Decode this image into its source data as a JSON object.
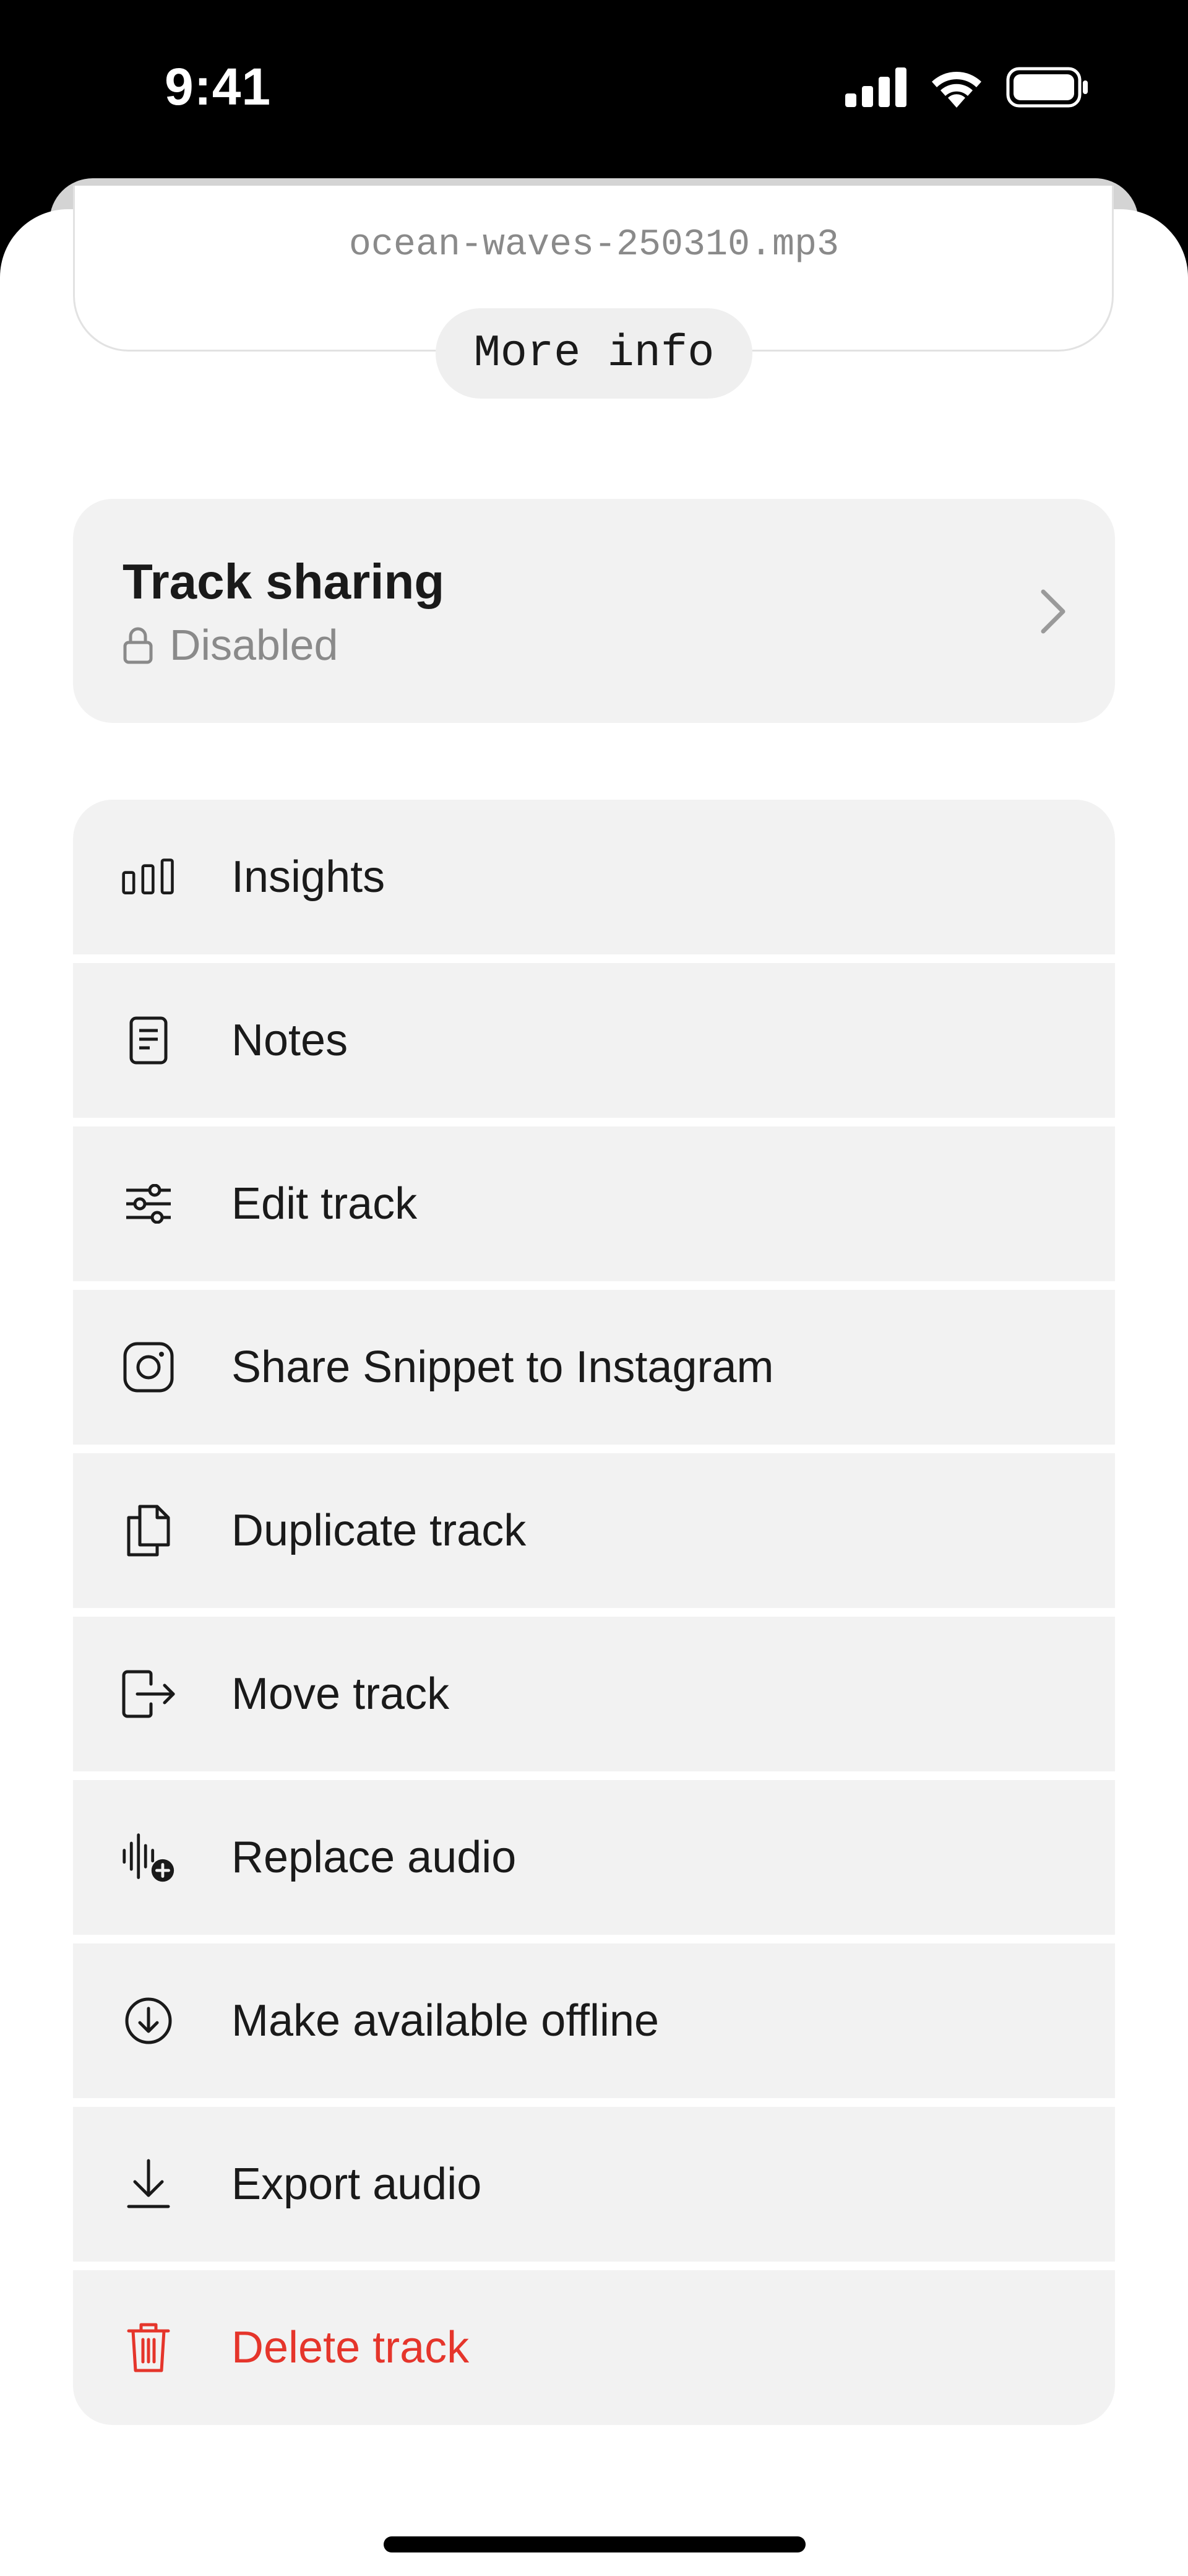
{
  "status_bar": {
    "time": "9:41",
    "icons": [
      "cellular-signal-icon",
      "wifi-icon",
      "battery-icon"
    ]
  },
  "file": {
    "name": "ocean-waves-250310.mp3",
    "more_info_label": "More info"
  },
  "track_sharing": {
    "title": "Track sharing",
    "status": "Disabled",
    "status_icon": "lock-icon",
    "chevron_icon": "chevron-right-icon"
  },
  "menu": {
    "items": [
      {
        "label": "Insights",
        "icon": "bar-chart-icon"
      },
      {
        "label": "Notes",
        "icon": "note-icon"
      },
      {
        "label": "Edit track",
        "icon": "sliders-icon"
      },
      {
        "label": "Share Snippet to Instagram",
        "icon": "instagram-icon"
      },
      {
        "label": "Duplicate track",
        "icon": "duplicate-icon"
      },
      {
        "label": "Move track",
        "icon": "move-icon"
      },
      {
        "label": "Replace audio",
        "icon": "replace-audio-icon"
      },
      {
        "label": "Make available offline",
        "icon": "download-circle-icon"
      },
      {
        "label": "Export audio",
        "icon": "export-icon"
      },
      {
        "label": "Delete track",
        "icon": "trash-icon"
      }
    ]
  },
  "colors": {
    "danger": "#e5352b",
    "card_background": "#f2f2f2",
    "secondary_text": "#8a8a8a"
  }
}
